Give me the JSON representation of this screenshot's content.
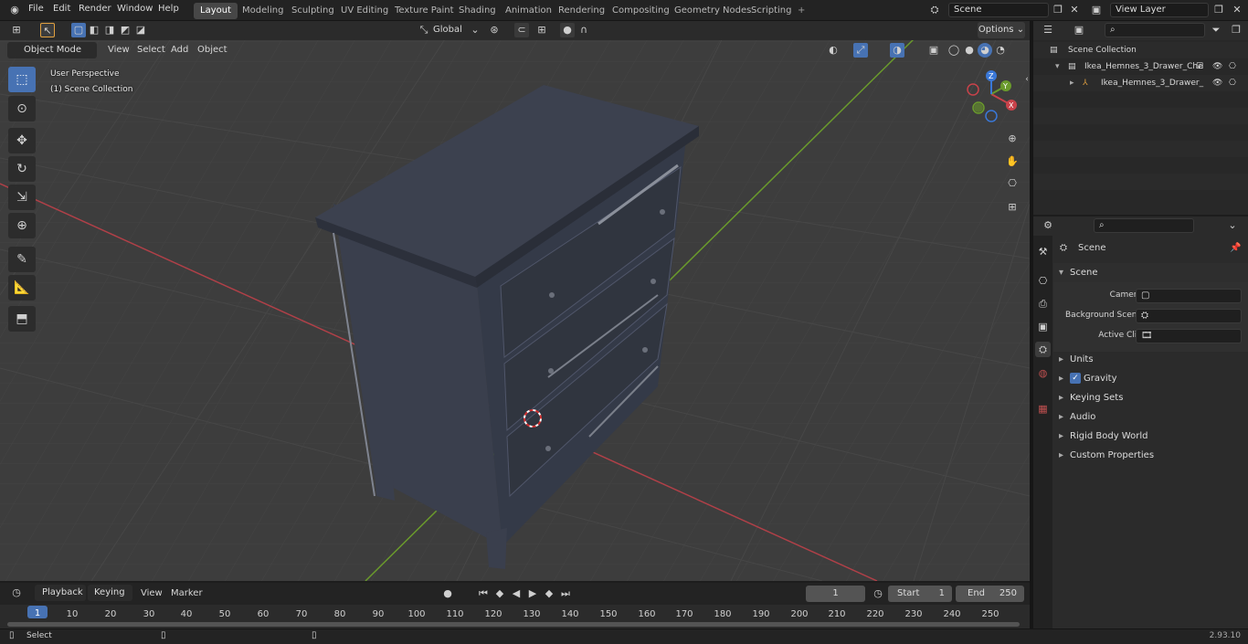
{
  "topbar": {
    "menus": [
      "File",
      "Edit",
      "Render",
      "Window",
      "Help"
    ],
    "workspaces": [
      "Layout",
      "Modeling",
      "Sculpting",
      "UV Editing",
      "Texture Paint",
      "Shading",
      "Animation",
      "Rendering",
      "Compositing",
      "Geometry Nodes",
      "Scripting"
    ],
    "active_workspace": "Layout",
    "add_tab": "+",
    "scene_name": "Scene",
    "view_layer": "View Layer"
  },
  "viewport_header": {
    "mode": "Object Mode",
    "menus": [
      "View",
      "Select",
      "Add",
      "Object"
    ],
    "transform_orientation": "Global",
    "options_label": "Options"
  },
  "viewport": {
    "perspective_label": "User Perspective",
    "collection_label": "(1) Scene Collection",
    "gizmo_axes": [
      "X",
      "Y",
      "Z"
    ]
  },
  "outliner": {
    "root": "Scene Collection",
    "items": [
      {
        "label": "Ikea_Hemnes_3_Drawer_Che"
      },
      {
        "label": "Ikea_Hemnes_3_Drawer_"
      }
    ]
  },
  "properties": {
    "context_title": "Scene",
    "section_title": "Scene",
    "fields": [
      {
        "label": "Camera",
        "value": ""
      },
      {
        "label": "Background Scene",
        "value": ""
      },
      {
        "label": "Active Clip",
        "value": ""
      }
    ],
    "panels": [
      "Units",
      "Gravity",
      "Keying Sets",
      "Audio",
      "Rigid Body World",
      "Custom Properties"
    ],
    "gravity_checked": true
  },
  "timeline": {
    "menus": [
      "Playback",
      "Keying",
      "View",
      "Marker"
    ],
    "current_frame": "1",
    "start_label": "Start",
    "start_value": "1",
    "end_label": "End",
    "end_value": "250",
    "ticks": [
      "1",
      "10",
      "20",
      "30",
      "40",
      "50",
      "60",
      "70",
      "80",
      "90",
      "100",
      "110",
      "120",
      "130",
      "140",
      "150",
      "160",
      "170",
      "180",
      "190",
      "200",
      "210",
      "220",
      "230",
      "240",
      "250"
    ]
  },
  "statusbar": {
    "left_label": "Select",
    "version": "2.93.10"
  },
  "colors": {
    "accent": "#4772b3",
    "x_axis": "#c8424a",
    "y_axis": "#6a9a2c",
    "z_axis": "#3a78d8",
    "viewport_bg": "#3d3d3d"
  }
}
